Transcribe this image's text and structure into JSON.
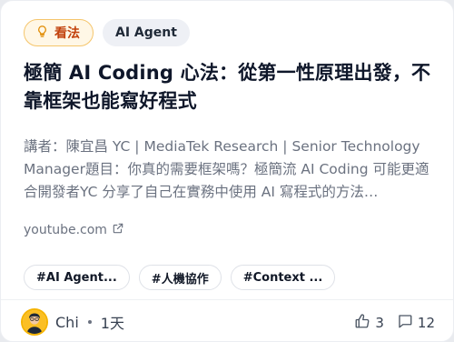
{
  "card": {
    "badge_insight": "看法",
    "badge_tag": "AI Agent",
    "title": "極簡 AI Coding 心法：從第一性原理出發，不靠框架也能寫好程式",
    "description": "講者：陳宜昌 YC | MediaTek Research | Senior Technology Manager題目：你真的需要框架嗎？極簡流 AI Coding 可能更適合開發者YC 分享了自己在實務中使用 AI 寫程式的方法…",
    "link": "youtube.com",
    "hashtags": [
      "#AI Agent...",
      "#人機協作",
      "#Context ..."
    ],
    "author": "Chi",
    "time": "1天",
    "likes": "3",
    "comments": "12"
  },
  "colors": {
    "insight_bg": "#fff7e6",
    "insight_border": "#f5c56b",
    "insight_text": "#c2410c",
    "avatar_ring": "#f5b301"
  },
  "icons": {
    "insight": "lightbulb-icon",
    "link": "external-link-icon",
    "like": "thumbs-up-icon",
    "comment": "comment-icon"
  }
}
